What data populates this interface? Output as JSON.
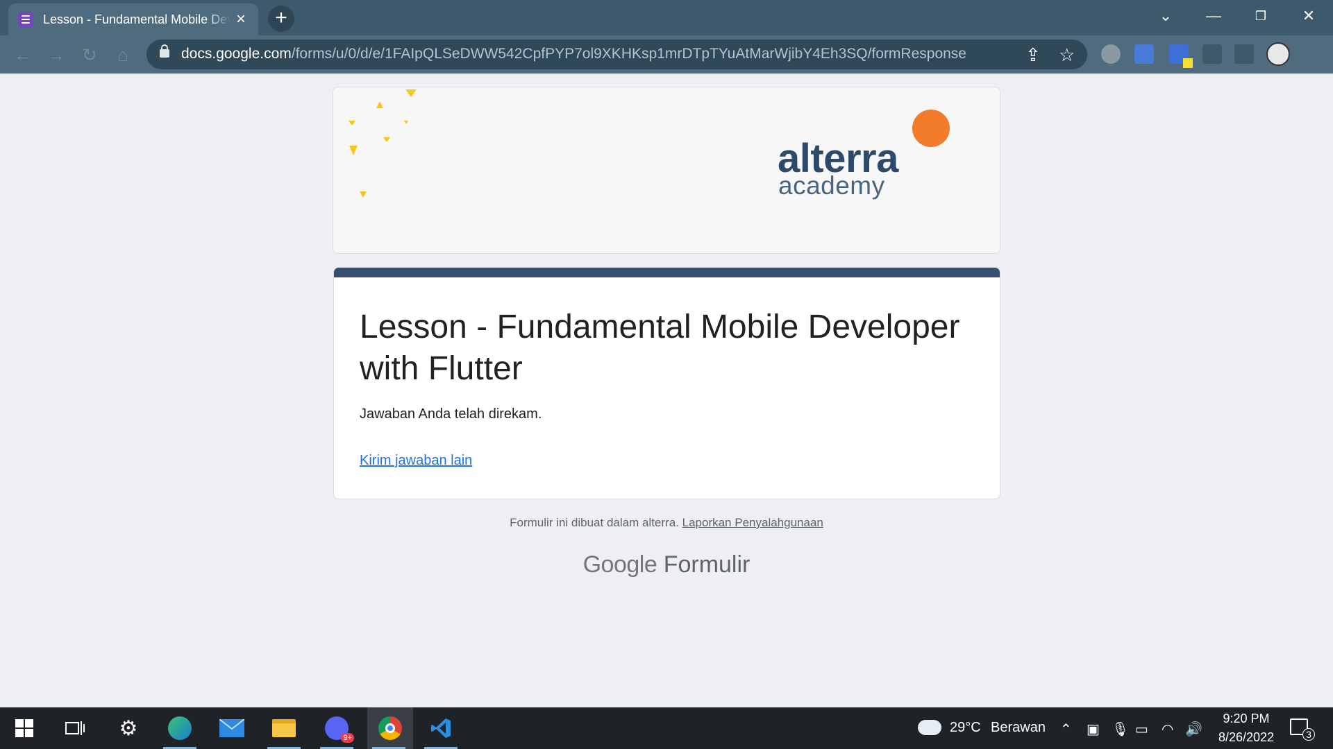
{
  "browser": {
    "tab_title": "Lesson - Fundamental Mobile Developer with Flutter",
    "new_tab": "+",
    "url_host": "docs.google.com",
    "url_path": "/forms/u/0/d/e/1FAIpQLSeDWW542CpfPYP7ol9XKHKsp1mrDTpTYuAtMarWjibY4Eh3SQ/formResponse"
  },
  "banner": {
    "brand": "alterra",
    "brand_sub": "academy"
  },
  "form": {
    "title": "Lesson - Fundamental Mobile Developer with Flutter",
    "confirmation": "Jawaban Anda telah direkam.",
    "submit_another": "Kirim jawaban lain"
  },
  "footer": {
    "note": "Formulir ini dibuat dalam alterra.",
    "report_link": "Laporkan Penyalahgunaan",
    "google": "Google",
    "product": "Formulir"
  },
  "taskbar": {
    "weather_temp": "29°C",
    "weather_desc": "Berawan",
    "time": "9:20 PM",
    "date": "8/26/2022",
    "notification_count": "3",
    "discord_badge": "9+"
  },
  "colors": {
    "accent": "#374e70",
    "link": "#1a73e8",
    "brand_orange": "#f27b2c",
    "tab_bar": "#3c5a6b"
  }
}
